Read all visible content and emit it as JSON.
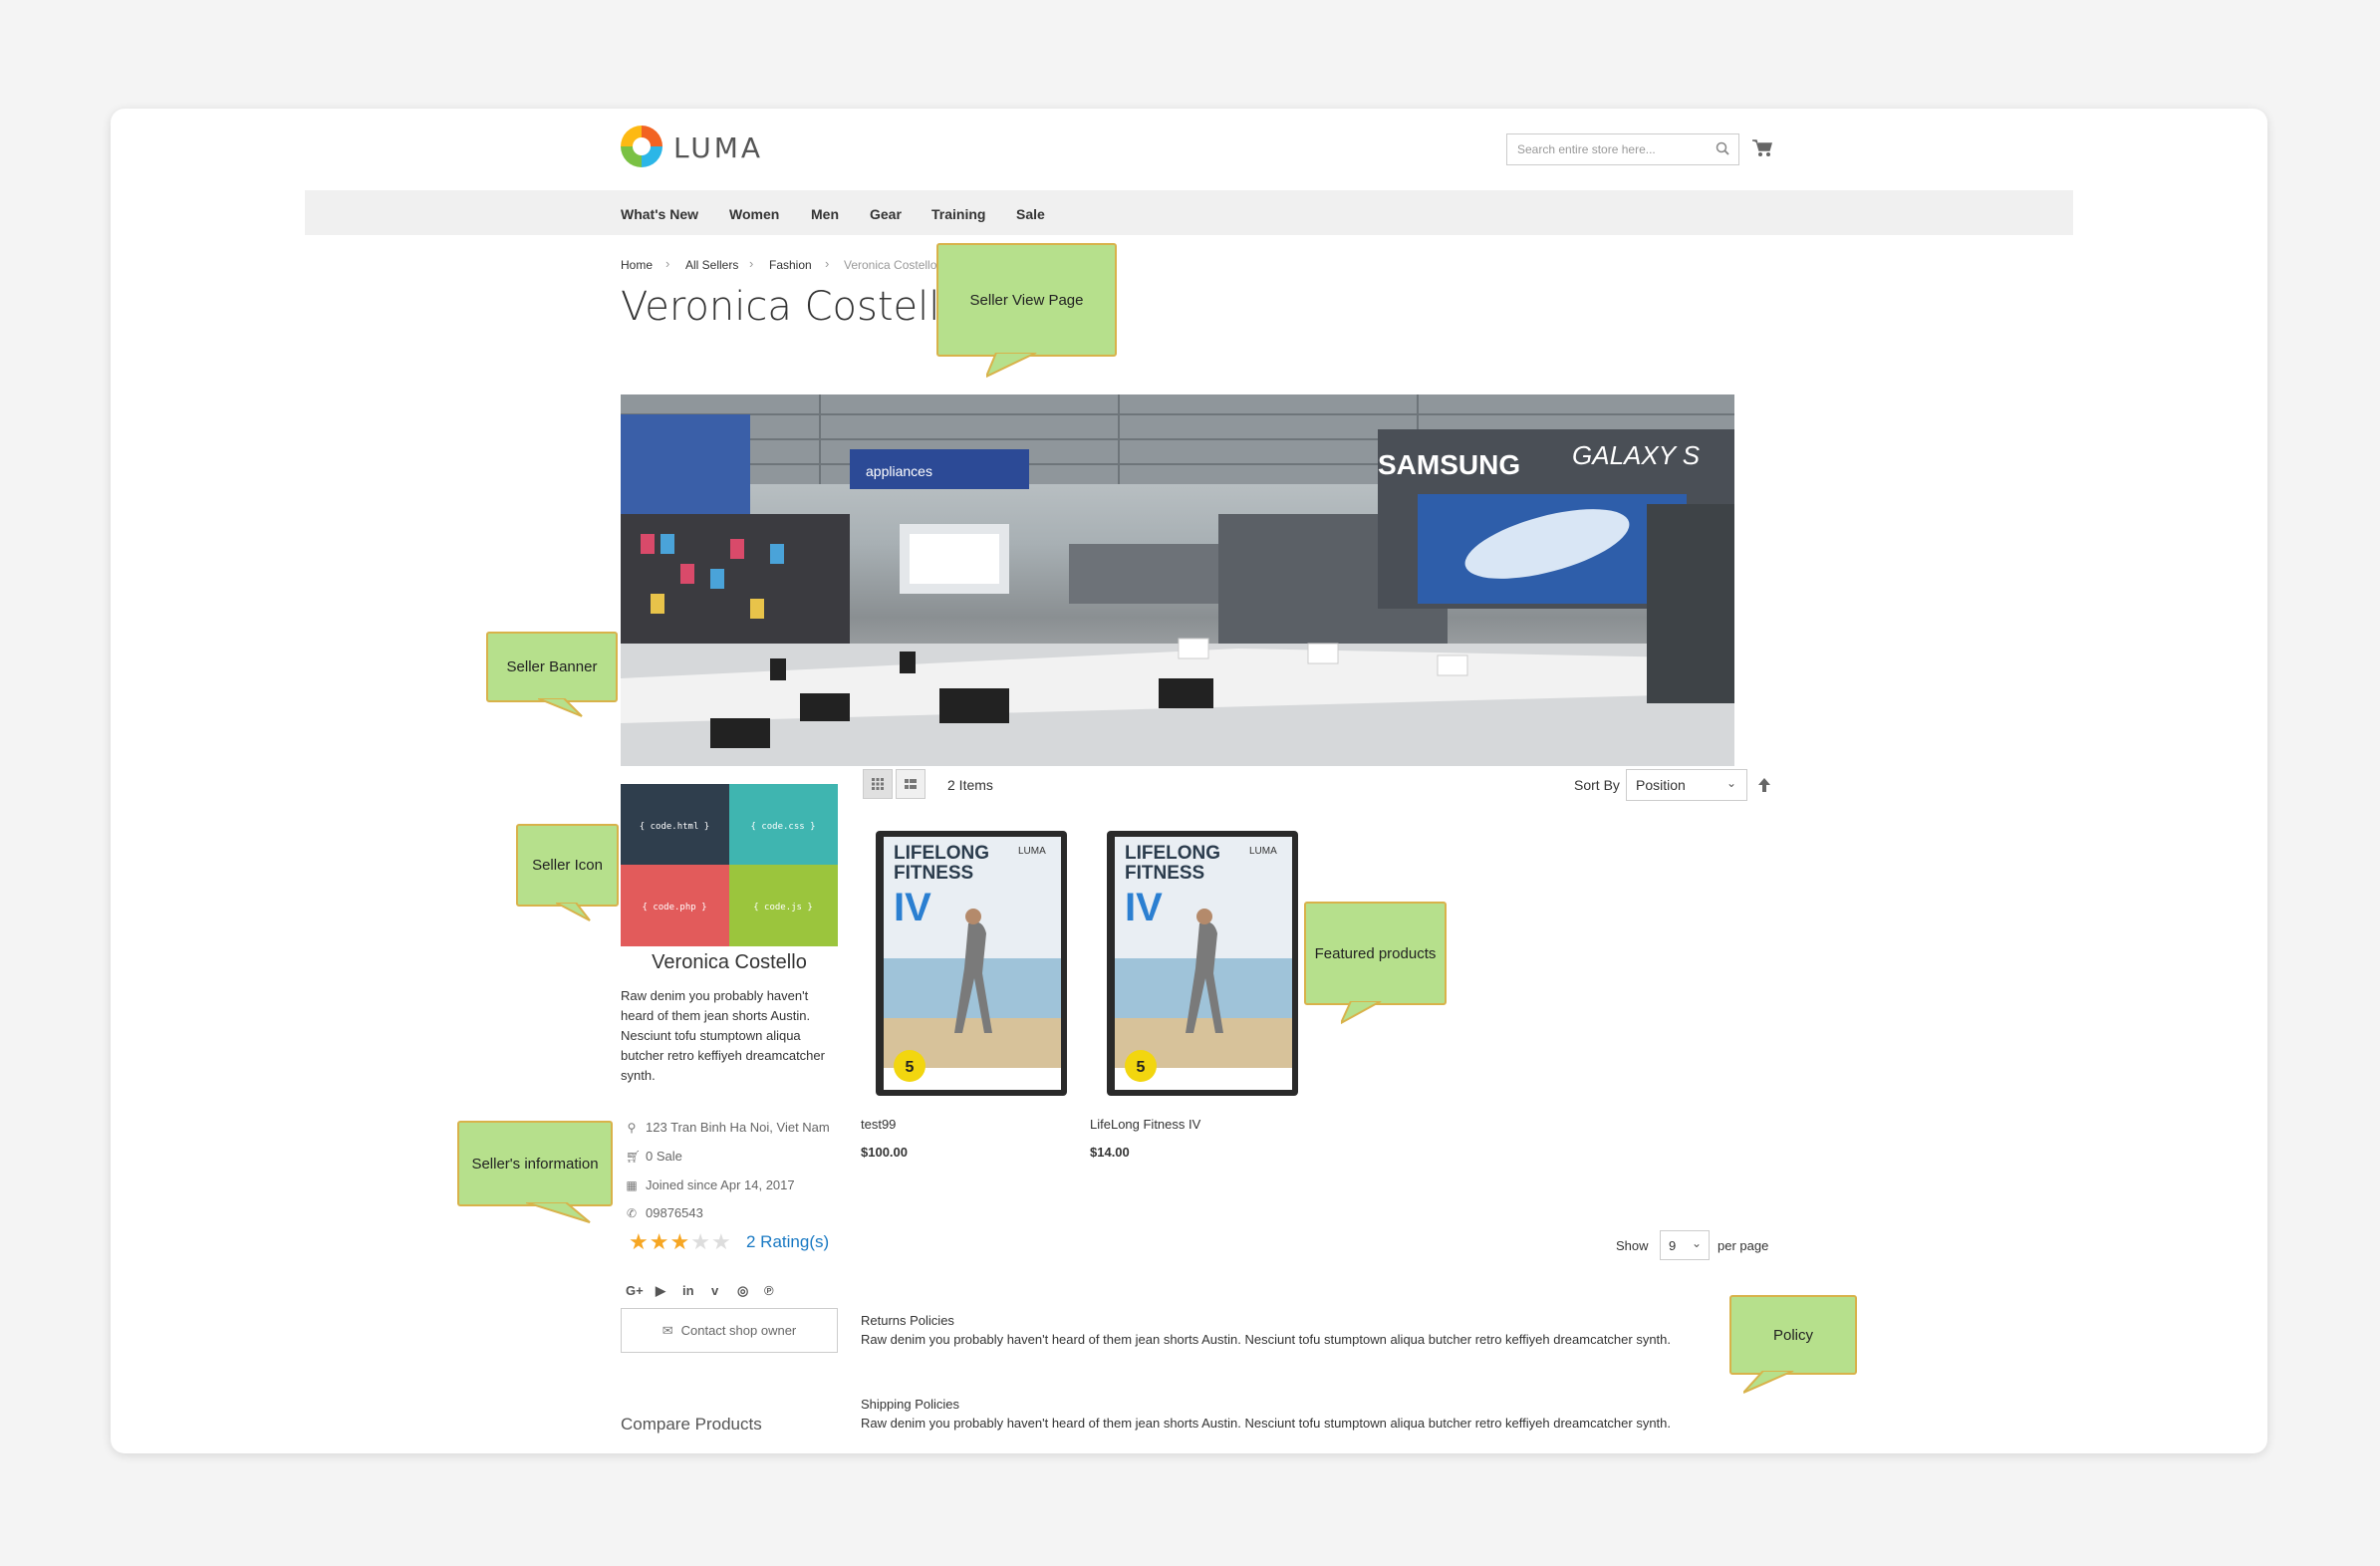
{
  "header": {
    "logo_text": "LUMA",
    "search_placeholder": "Search entire store here..."
  },
  "nav": [
    "What's New",
    "Women",
    "Men",
    "Gear",
    "Training",
    "Sale"
  ],
  "breadcrumb": [
    "Home",
    "All Sellers",
    "Fashion",
    "Veronica Costello"
  ],
  "page_title": "Veronica Costello",
  "banner": {
    "signs": [
      "appliances",
      "SAMSUNG",
      "GALAXY S"
    ]
  },
  "toolbar": {
    "items_count": "2 Items",
    "sort_label": "Sort By",
    "sort_value": "Position"
  },
  "seller": {
    "icon_tiles": [
      "{ code.html }",
      "{ code.css }",
      "{ code.php }",
      "{ code.js }"
    ],
    "name": "Veronica Costello",
    "description": "Raw denim you probably haven't heard of them jean shorts Austin. Nesciunt tofu stumptown aliqua butcher retro keffiyeh dreamcatcher synth.",
    "address": "123 Tran Binh Ha Noi, Viet Nam",
    "sales": "0 Sale",
    "joined": "Joined since Apr 14, 2017",
    "phone": "09876543",
    "rating_stars": 3,
    "rating_max": 5,
    "rating_link": "2 Rating(s)",
    "social": [
      "G+",
      "▶",
      "in",
      "v",
      "◎",
      "℗"
    ],
    "contact_label": "Contact shop owner"
  },
  "products": [
    {
      "name": "test99",
      "price": "$100.00",
      "cover_lines": [
        "LIFELONG",
        "FITNESS",
        "IV"
      ],
      "brand": "LUMA",
      "badge": "5"
    },
    {
      "name": "LifeLong Fitness IV",
      "price": "$14.00",
      "cover_lines": [
        "LIFELONG",
        "FITNESS",
        "IV"
      ],
      "brand": "LUMA",
      "badge": "5"
    }
  ],
  "pager": {
    "show_label": "Show",
    "limit": "9",
    "per_page_label": "per page"
  },
  "policies": [
    {
      "title": "Returns Policies",
      "text": "Raw denim you probably haven't heard of them jean shorts Austin. Nesciunt tofu stumptown aliqua butcher retro keffiyeh dreamcatcher synth."
    },
    {
      "title": "Shipping Policies",
      "text": "Raw denim you probably haven't heard of them jean shorts Austin. Nesciunt tofu stumptown aliqua butcher retro keffiyeh dreamcatcher synth."
    }
  ],
  "compare_title": "Compare Products",
  "callouts": {
    "seller_view_page": "Seller View Page",
    "seller_banner": "Seller Banner",
    "seller_icon": "Seller Icon",
    "sellers_information": "Seller's information",
    "featured_products": "Featured products",
    "policy": "Policy"
  },
  "colors": {
    "callout_fill": "#b6e08c",
    "callout_border": "#d8b24a",
    "link": "#1979c3",
    "star": "#f6a623"
  }
}
